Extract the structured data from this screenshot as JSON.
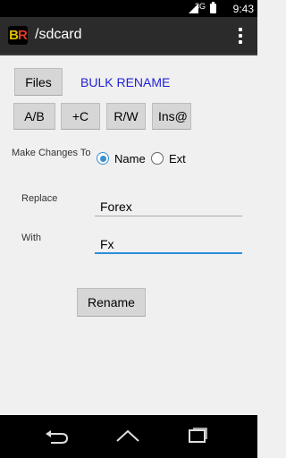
{
  "status": {
    "network": "3G",
    "time": "9:43"
  },
  "app": {
    "logo": {
      "b": "B",
      "r": "R"
    },
    "title": "/sdcard"
  },
  "buttons": {
    "files": "Files",
    "ab": "A/B",
    "c": "+C",
    "rw": "R/W",
    "ins": "Ins@",
    "rename": "Rename"
  },
  "mode_link": "BULK RENAME",
  "changes": {
    "label": "Make Changes To",
    "name": "Name",
    "ext": "Ext",
    "selected": "Name"
  },
  "replace": {
    "label": "Replace",
    "value": "Forex"
  },
  "with": {
    "label": "With",
    "value": "Fx"
  },
  "colors": {
    "accent": "#2a8fd9",
    "link": "#1f1fd6"
  }
}
